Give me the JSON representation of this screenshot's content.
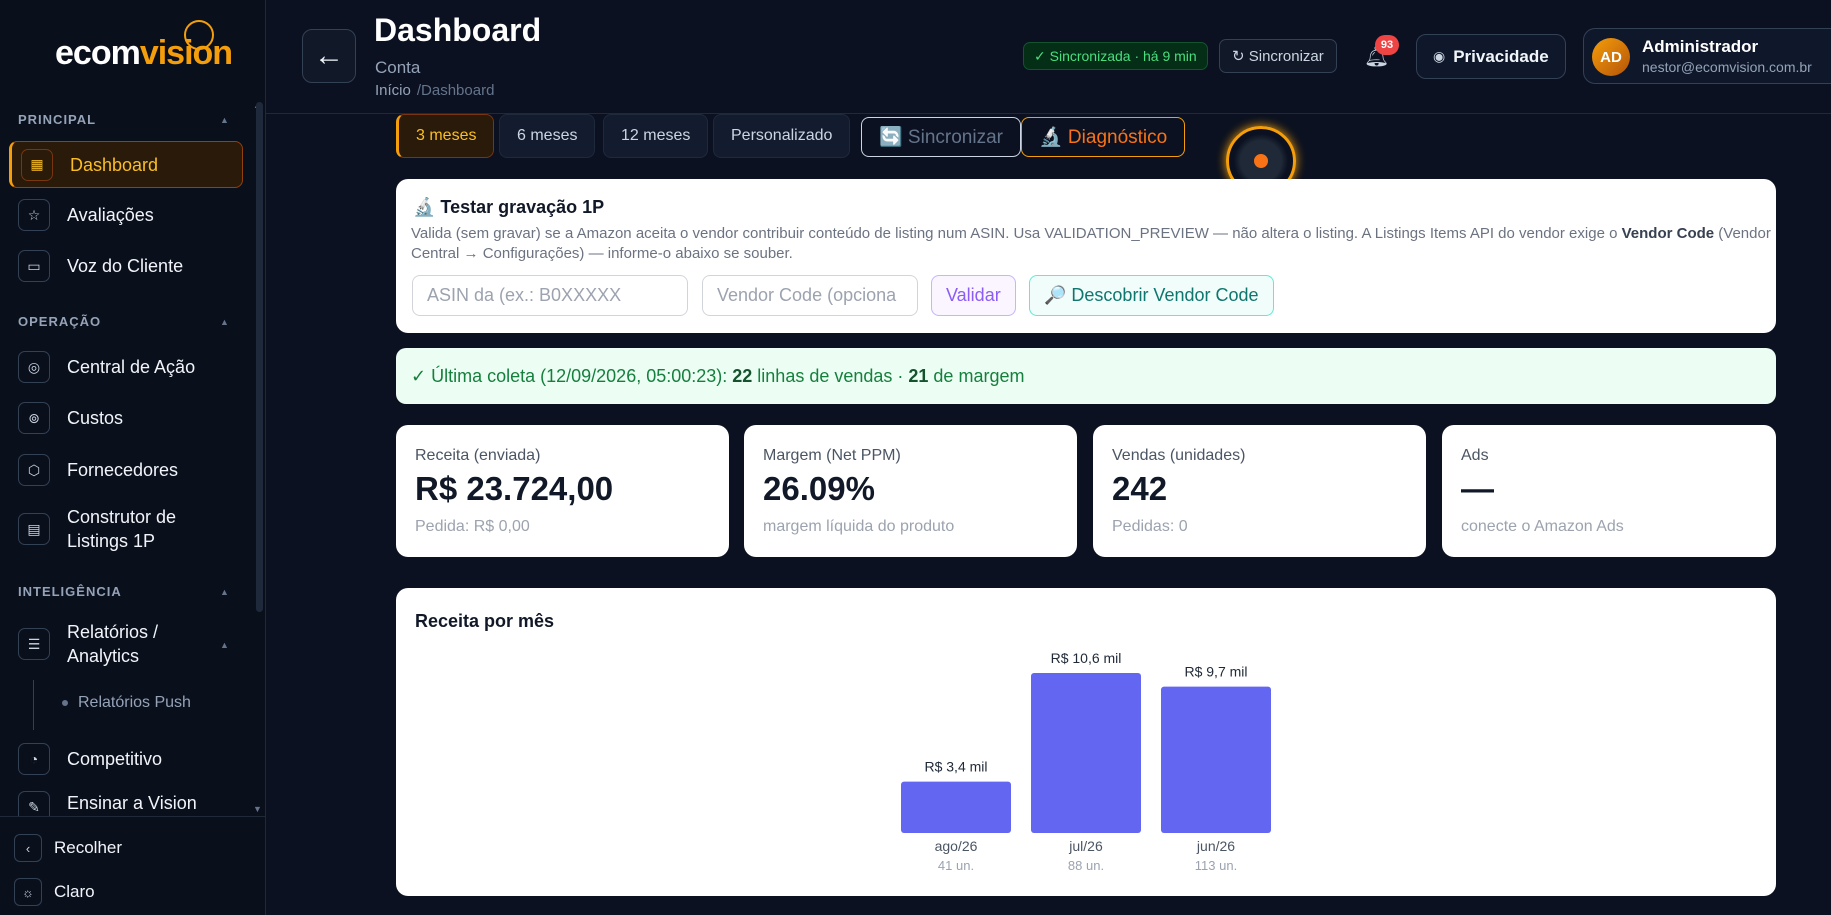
{
  "sidebar": {
    "logo_main": "ecom",
    "logo_accent": "vision",
    "sections": {
      "principal": "PRINCIPAL",
      "operacao": "OPERAÇÃO",
      "inteligencia": "INTELIGÊNCIA"
    },
    "items": {
      "dashboard": "Dashboard",
      "avaliacoes": "Avaliações",
      "voz": "Voz do Cliente",
      "central": "Central de Ação",
      "custos": "Custos",
      "fornecedores": "Fornecedores",
      "construtor": "Construtor de Listings 1P",
      "relatorios": "Relatórios / Analytics",
      "relatorios_push": "Relatórios Push",
      "competitivo": "Competitivo",
      "ensinar": "Ensinar a Vision"
    },
    "collapse": "Recolher",
    "theme": "Claro"
  },
  "header": {
    "title": "Dashboard",
    "subtitle": "Conta",
    "breadcrumb_home": "Início",
    "breadcrumb_current": "/Dashboard",
    "sync_status": "✓ Sincronizada · há 9 min",
    "sync_button": "↻ Sincronizar",
    "notifications": "93",
    "privacy": "Privacidade",
    "user_initials": "AD",
    "user_name": "Administrador",
    "user_email": "nestor@ecomvision.com.br"
  },
  "toolbar": {
    "range_3": "3 meses",
    "range_6": "6 meses",
    "range_12": "12 meses",
    "custom": "Personalizado",
    "sync": "🔄 Sincronizar",
    "diagnostic": "🔬 Diagnóstico"
  },
  "test_panel": {
    "title": "🔬 Testar gravação 1P",
    "desc_start": "Valida (sem gravar) se a Amazon aceita o vendor contribuir conteúdo de listing num ASIN. Usa VALIDATION_PREVIEW — não altera o listing. A Listings Items API do vendor exige o ",
    "desc_bold": "Vendor Code",
    "desc_end": " (Vendor Central → Configurações) — informe-o abaixo se souber.",
    "asin_placeholder": "ASIN da          (ex.: B0XXXXX",
    "vendor_placeholder": "Vendor Code (opciona",
    "validate": "Validar",
    "discover": "🔎 Descobrir Vendor Code"
  },
  "collection": {
    "prefix": "✓ Última coleta (12/09/2026, 05:00:23):",
    "sales_count": "22",
    "sales_text": "linhas de vendas ·",
    "margin_count": "21",
    "margin_text": "de margem"
  },
  "kpis": [
    {
      "label": "Receita (enviada)",
      "value": "R$ 23.724,00",
      "foot": "Pedida: R$ 0,00"
    },
    {
      "label": "Margem (Net PPM)",
      "value": "26.09%",
      "foot": "margem líquida do produto"
    },
    {
      "label": "Vendas (unidades)",
      "value": "242",
      "foot": "Pedidas: 0"
    },
    {
      "label": "Ads",
      "value": "—",
      "foot": "conecte o Amazon Ads"
    }
  ],
  "chart_data": {
    "type": "bar",
    "title": "Receita por mês",
    "categories": [
      "ago/26",
      "jul/26",
      "jun/26"
    ],
    "values": [
      3.4,
      10.6,
      9.7
    ],
    "value_labels": [
      "R$ 3,4 mil",
      "R$ 10,6 mil",
      "R$ 9,7 mil"
    ],
    "units_labels": [
      "41 un.",
      "88 un.",
      "113 un."
    ],
    "ylim": [
      0,
      10.6
    ],
    "color": "#6366f1"
  },
  "colors": {
    "accent": "#f59e0b",
    "background": "#0b1120",
    "bar": "#6366f1",
    "success": "#15803d"
  }
}
